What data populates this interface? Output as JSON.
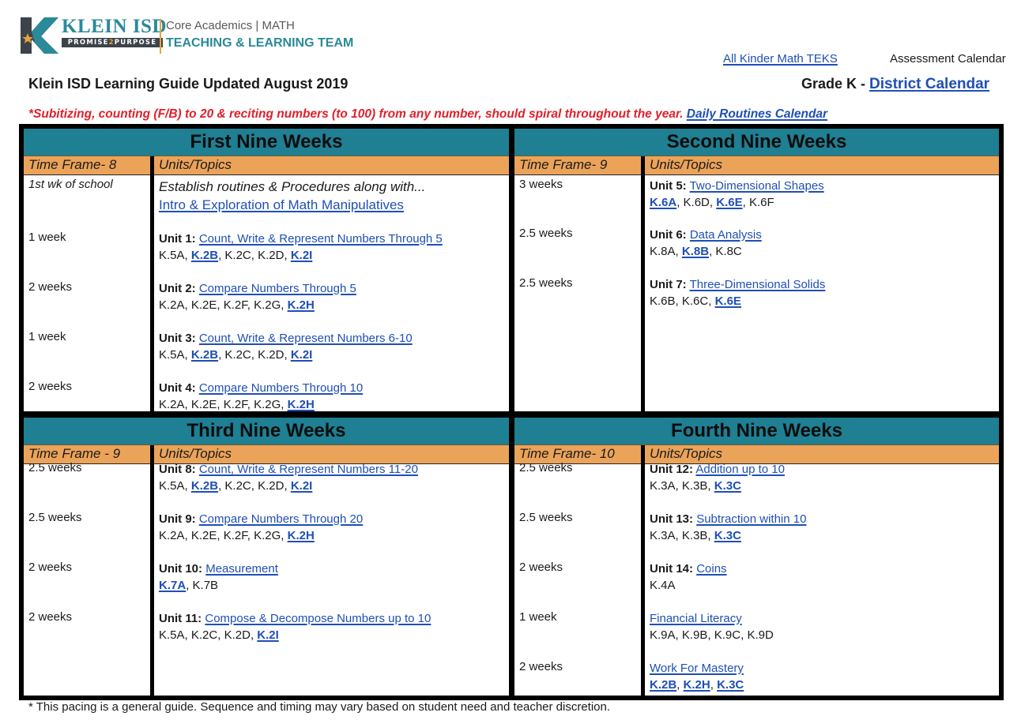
{
  "header": {
    "logo": {
      "wordmark": "KLEIN ISD",
      "tagline_pre": "PROMISE",
      "tagline_mid": "2",
      "tagline_post": "PURPOSE",
      "line1": "Core Academics | MATH",
      "line2": "TEACHING & LEARNING TEAM"
    },
    "all_teks_link": "All Kinder Math TEKS",
    "assessment_calendar": "Assessment Calendar",
    "title": "Klein ISD Learning Guide Updated August 2019",
    "grade_label": "Grade K  - ",
    "district_calendar_link": "District Calendar",
    "note": "*Subitizing, counting (F/B) to 20 & reciting numbers (to 100) from any number, should spiral throughout the year. ",
    "daily_routines_link": "Daily Routines Calendar"
  },
  "colors": {
    "section_header": "#1f7f93",
    "column_header": "#eba35a",
    "link": "#1f4fb5",
    "note_red": "#e0202a",
    "logo_teal": "#2a8a98",
    "logo_gold": "#e8a33a"
  },
  "quarters": [
    {
      "title": "First Nine Weeks",
      "time_frame": "Time Frame- 8",
      "units_header": "Units/Topics",
      "rows": [
        {
          "weeks": "1st wk of school",
          "unit_label": "",
          "intro": "Establish routines & Procedures along with...",
          "topic": "Intro & Exploration of Math Manipulatives",
          "standards": []
        },
        {
          "weeks": "1 week",
          "unit_label": "Unit 1:",
          "topic": "Count, Write & Represent Numbers Through 5",
          "standards": [
            {
              "t": "K.5A",
              "link": false
            },
            {
              "t": "K.2B",
              "link": true
            },
            {
              "t": "K.2C",
              "link": false
            },
            {
              "t": "K.2D",
              "link": false
            },
            {
              "t": "K.2I",
              "link": true
            }
          ]
        },
        {
          "weeks": "2 weeks",
          "unit_label": "Unit 2:",
          "topic": "Compare Numbers Through 5",
          "standards": [
            {
              "t": "K.2A",
              "link": false
            },
            {
              "t": "K.2E",
              "link": false
            },
            {
              "t": "K.2F",
              "link": false
            },
            {
              "t": "K.2G",
              "link": false
            },
            {
              "t": "K.2H",
              "link": true
            }
          ]
        },
        {
          "weeks": "1 week",
          "unit_label": "Unit 3:",
          "topic": "Count, Write & Represent Numbers 6-10",
          "standards": [
            {
              "t": "K.5A",
              "link": false
            },
            {
              "t": "K.2B",
              "link": true
            },
            {
              "t": "K.2C",
              "link": false
            },
            {
              "t": "K.2D",
              "link": false
            },
            {
              "t": "K.2I",
              "link": true
            }
          ]
        },
        {
          "weeks": "2 weeks",
          "unit_label": "Unit 4:",
          "topic": "Compare Numbers Through 10",
          "standards": [
            {
              "t": "K.2A",
              "link": false
            },
            {
              "t": "K.2E",
              "link": false
            },
            {
              "t": "K.2F",
              "link": false
            },
            {
              "t": "K.2G",
              "link": false
            },
            {
              "t": "K.2H",
              "link": true
            }
          ]
        }
      ]
    },
    {
      "title": "Second Nine Weeks",
      "time_frame": "Time Frame- 9",
      "units_header": "Units/Topics",
      "rows": [
        {
          "weeks": "3 weeks",
          "unit_label": "Unit 5:",
          "topic": "Two-Dimensional Shapes",
          "standards": [
            {
              "t": "K.6A",
              "link": true
            },
            {
              "t": "K.6D",
              "link": false
            },
            {
              "t": "K.6E",
              "link": true
            },
            {
              "t": "K.6F",
              "link": false
            }
          ]
        },
        {
          "weeks": "2.5 weeks",
          "unit_label": "Unit 6:",
          "topic": "Data Analysis",
          "standards": [
            {
              "t": "K.8A",
              "link": false
            },
            {
              "t": "K.8B",
              "link": true
            },
            {
              "t": "K.8C",
              "link": false
            }
          ]
        },
        {
          "weeks": "2.5 weeks",
          "unit_label": "Unit 7:",
          "topic": "Three-Dimensional Solids",
          "standards": [
            {
              "t": "K.6B",
              "link": false
            },
            {
              "t": "K.6C",
              "link": false
            },
            {
              "t": "K.6E",
              "link": true
            }
          ]
        }
      ]
    },
    {
      "title": "Third Nine Weeks",
      "time_frame": "Time Frame - 9",
      "units_header": "Units/Topics",
      "rows": [
        {
          "weeks": "2.5 weeks",
          "unit_label": "Unit 8:",
          "topic": "Count, Write & Represent Numbers 11-20",
          "standards": [
            {
              "t": "K.5A",
              "link": false
            },
            {
              "t": "K.2B",
              "link": true
            },
            {
              "t": "K.2C",
              "link": false
            },
            {
              "t": "K.2D",
              "link": false
            },
            {
              "t": "K.2I",
              "link": true
            }
          ]
        },
        {
          "weeks": "2.5 weeks",
          "unit_label": "Unit 9:",
          "topic": "Compare Numbers Through 20",
          "standards": [
            {
              "t": "K.2A",
              "link": false
            },
            {
              "t": "K.2E",
              "link": false
            },
            {
              "t": "K.2F",
              "link": false
            },
            {
              "t": "K.2G",
              "link": false
            },
            {
              "t": "K.2H",
              "link": true
            }
          ]
        },
        {
          "weeks": "2 weeks",
          "unit_label": "Unit 10:",
          "topic": "Measurement",
          "standards": [
            {
              "t": "K.7A",
              "link": true
            },
            {
              "t": "K.7B",
              "link": false
            }
          ]
        },
        {
          "weeks": "2 weeks",
          "unit_label": "Unit 11:",
          "topic": "Compose & Decompose Numbers up to 10",
          "standards": [
            {
              "t": "K.5A",
              "link": false
            },
            {
              "t": "K.2C",
              "link": false
            },
            {
              "t": "K.2D",
              "link": false
            },
            {
              "t": "K.2I",
              "link": true
            }
          ]
        }
      ]
    },
    {
      "title": "Fourth Nine Weeks",
      "time_frame": "Time Frame- 10",
      "units_header": "Units/Topics",
      "rows": [
        {
          "weeks": "2.5 weeks",
          "unit_label": "Unit 12:",
          "topic": "Addition up to 10",
          "standards": [
            {
              "t": "K.3A",
              "link": false
            },
            {
              "t": "K.3B",
              "link": false
            },
            {
              "t": "K.3C",
              "link": true
            }
          ]
        },
        {
          "weeks": "2.5 weeks",
          "unit_label": "Unit 13:",
          "topic": "Subtraction within 10",
          "standards": [
            {
              "t": "K.3A",
              "link": false
            },
            {
              "t": "K.3B",
              "link": false
            },
            {
              "t": "K.3C",
              "link": true
            }
          ]
        },
        {
          "weeks": "2 weeks",
          "unit_label": "Unit 14:",
          "topic": "Coins",
          "standards": [
            {
              "t": "K.4A",
              "link": false
            }
          ]
        },
        {
          "weeks": "1 week",
          "unit_label": "",
          "topic": "Financial Literacy",
          "standards": [
            {
              "t": "K.9A",
              "link": false
            },
            {
              "t": "K.9B",
              "link": false
            },
            {
              "t": "K.9C",
              "link": false
            },
            {
              "t": "K.9D",
              "link": false
            }
          ]
        },
        {
          "weeks": "2 weeks",
          "unit_label": "",
          "topic": "Work For Mastery",
          "standards": [
            {
              "t": "K.2B",
              "link": true
            },
            {
              "t": "K.2H",
              "link": true
            },
            {
              "t": "K.3C",
              "link": true
            }
          ]
        }
      ]
    }
  ],
  "footer": "* This pacing is a general guide.  Sequence and timing may vary based on student need and teacher discretion."
}
